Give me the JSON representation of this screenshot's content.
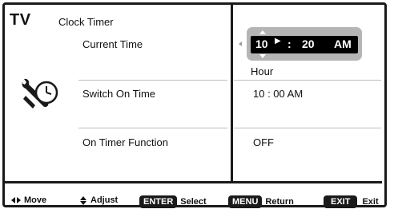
{
  "header": {
    "brand": "TV",
    "menu_title": "Clock Timer"
  },
  "rows": {
    "current_time": {
      "label": "Current Time",
      "hour": "10",
      "separator": ":",
      "minute": "20",
      "ampm": "AM",
      "field_hint": "Hour"
    },
    "switch_on_time": {
      "label": "Switch On Time",
      "value": "10 : 00  AM"
    },
    "on_timer_function": {
      "label": "On Timer Function",
      "value": "OFF"
    }
  },
  "footer": {
    "move_label": "Move",
    "adjust_label": "Adjust",
    "enter_key": "ENTER",
    "enter_label": "Select",
    "menu_key": "MENU",
    "menu_label": "Return",
    "exit_key": "EXIT",
    "exit_label": "Exit"
  },
  "icons": {
    "timer_tool": "wrench-clock-icon"
  },
  "colors": {
    "frame": "#1a1a1a",
    "selection_bg": "#b5b5b5",
    "selection_fg": "#000000"
  }
}
